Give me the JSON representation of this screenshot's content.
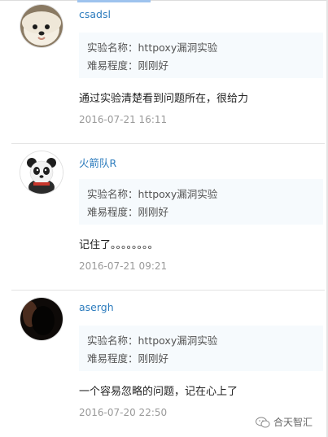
{
  "comments": [
    {
      "username": "csadsl",
      "info_name": "实验名称：httpoxy漏洞实验",
      "info_level": "难易程度：刚刚好",
      "text": "通过实验清楚看到问题所在，很给力",
      "time": "2016-07-21 16:11",
      "avatar_icon": "puppy-avatar"
    },
    {
      "username": "火箭队R",
      "info_name": "实验名称：httpoxy漏洞实验",
      "info_level": "难易程度：刚刚好",
      "text": "记住了。。。。。。。。",
      "time": "2016-07-21 09:21",
      "avatar_icon": "panda-avatar"
    },
    {
      "username": "asergh",
      "info_name": "实验名称：httpoxy漏洞实验",
      "info_level": "难易程度：刚刚好",
      "text": "一个容易忽略的问题，记在心上了",
      "time": "2016-07-20 22:50",
      "avatar_icon": "dark-avatar"
    }
  ],
  "watermark": {
    "text": "合天智汇",
    "icon": "wechat-icon"
  },
  "colors": {
    "username": "#2b7bbd",
    "info_bg": "#f6fafd",
    "time": "#9a9a9a"
  }
}
